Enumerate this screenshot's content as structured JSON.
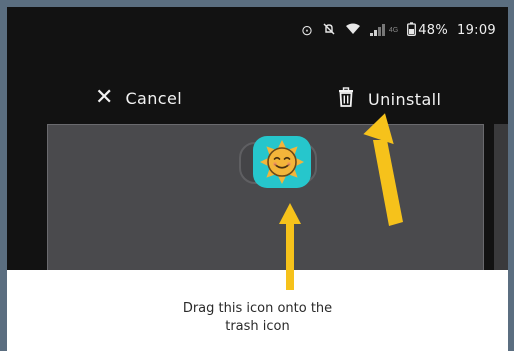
{
  "statusbar": {
    "icons": [
      "sync-icon",
      "mute-icon",
      "wifi-icon",
      "signal-icon",
      "battery-icon"
    ],
    "battery": "48%",
    "time": "19:09",
    "network_badge": "4G"
  },
  "actionbar": {
    "cancel_label": "Cancel",
    "uninstall_label": "Uninstall"
  },
  "caption": {
    "line1": "Drag this icon onto the",
    "line2": "trash icon"
  },
  "colors": {
    "frame": "#5b6e80",
    "screen_bg": "#121212",
    "panel": "#4a4a4d",
    "app_icon_bg": "#26c6cc",
    "sun": "#f3b53a",
    "arrow": "#f6c21b"
  }
}
